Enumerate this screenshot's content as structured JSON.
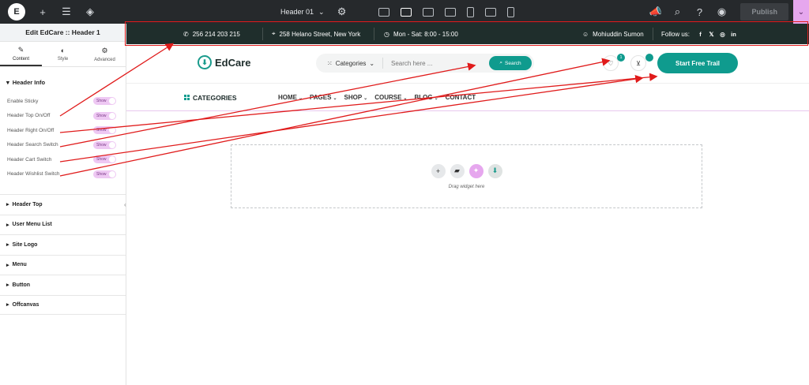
{
  "topbar": {
    "logo": "E",
    "template_title": "Header 01",
    "publish_label": "Publish"
  },
  "panel": {
    "header": "Edit EdCare :: Header 1",
    "tabs": [
      {
        "label": "Content",
        "icon": "pencil-icon"
      },
      {
        "label": "Style",
        "icon": "contrast-icon"
      },
      {
        "label": "Advanced",
        "icon": "gear-icon"
      }
    ],
    "section_title": "Header Info",
    "controls": [
      {
        "label": "Enable Sticky",
        "value": "Show"
      },
      {
        "label": "Header Top On/Off",
        "value": "Show"
      },
      {
        "label": "Header Right On/Off",
        "value": "Show"
      },
      {
        "label": "Header Search Switch",
        "value": "Show"
      },
      {
        "label": "Header Cart Switch",
        "value": "Show"
      },
      {
        "label": "Header Wishlist Switch",
        "value": "Show"
      }
    ],
    "collapsed_sections": [
      "Header Top",
      "User Menu List",
      "Site Logo",
      "Menu",
      "Button",
      "Offcanvas"
    ]
  },
  "header_top": {
    "phone": "256 214 203 215",
    "address": "258 Helano Street, New York",
    "hours": "Mon - Sat: 8:00 - 15:00",
    "user": "Mohiuddin Sumon",
    "follow_label": "Follow us:"
  },
  "header_main": {
    "logo_text": "EdCare",
    "categories_label": "Categories",
    "search_placeholder": "Search here ...",
    "search_button": "Search",
    "wishlist_count": "1",
    "cta_label": "Start Free Trail"
  },
  "nav": {
    "categories": "CATEGORIES",
    "menu": [
      "HOME",
      "PAGES",
      "SHOP",
      "COURSE",
      "BLOG",
      "CONTACT"
    ]
  },
  "dropzone": {
    "text": "Drag widget here"
  },
  "colors": {
    "accent": "#0f9b8e",
    "dark_bar": "#1f2e2c",
    "editor_bar": "#26292c",
    "highlight": "#e01b1b",
    "pink": "#e6a7ee"
  }
}
